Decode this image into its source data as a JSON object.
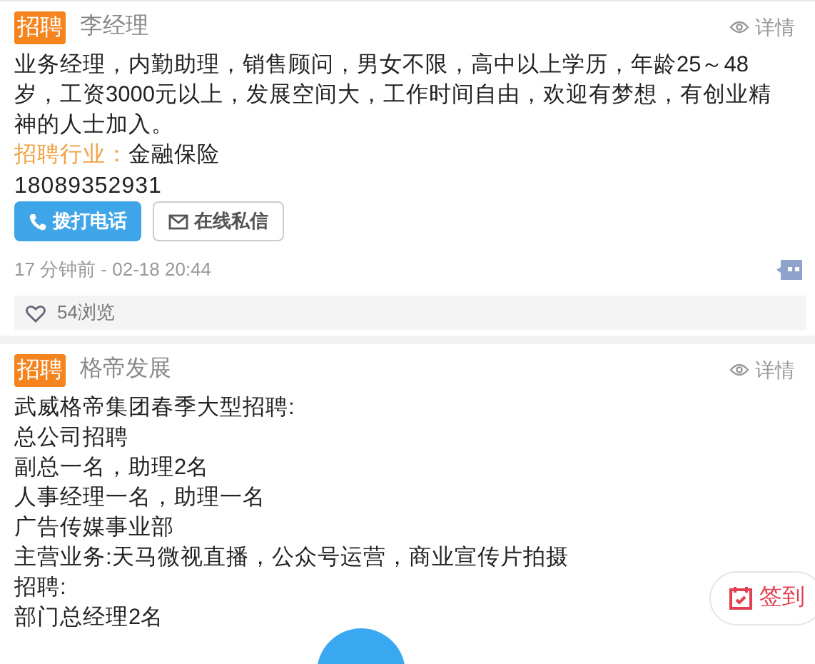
{
  "posts": [
    {
      "tag": "招聘",
      "author": "李经理",
      "detail": "详情",
      "lines": [
        "业务经理，内勤助理，销售顾问，男女不限，高中以上学历，年龄25～48岁，工资3000元以上，发展空间大，工作时间自由，欢迎有梦想，有创业精神的人士加入。"
      ],
      "industry_label": "招聘行业：",
      "industry": "金融保险",
      "phone": "18089352931",
      "buttons": [
        {
          "label": "拨打电话",
          "kind": "call"
        },
        {
          "label": "在线私信",
          "kind": "message"
        }
      ],
      "time": "17 分钟前 - 02-18 20:44",
      "views": "54浏览"
    },
    {
      "tag": "招聘",
      "author": "格帝发展",
      "detail": "详情",
      "lines": [
        "武威格帝集团春季大型招聘:",
        "总公司招聘",
        "副总一名，助理2名",
        "人事经理一名，助理一名",
        "广告传媒事业部",
        "主营业务:天马微视直播，公众号运营，商业宣传片拍摄",
        "招聘:",
        "部门总经理2名"
      ]
    }
  ],
  "checkin": {
    "label": "签到"
  }
}
